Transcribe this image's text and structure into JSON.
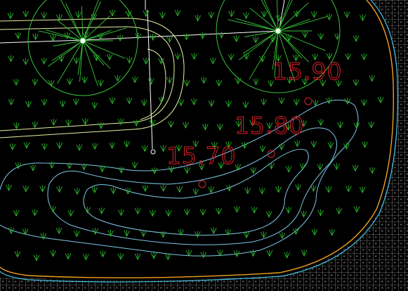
{
  "canvas": {
    "background": "#000000",
    "colors": {
      "contour": "#7fc8e6",
      "pond_edge_orange": "#f0a020",
      "pond_edge_cyan": "#49c3e8",
      "planting_green": "#2bb52b",
      "tree_green": "#39c43a",
      "path_lines": "#e6f0a0",
      "elevation_text": "#e0202a",
      "guide_white": "#ffffff",
      "paving_gray": "#cfcfcf"
    }
  },
  "elevation_markers": [
    {
      "label": "15.90",
      "icon": "spot-elevation-circle"
    },
    {
      "label": "15.80",
      "icon": "spot-elevation-circle"
    },
    {
      "label": "15.70",
      "icon": "spot-elevation-circle"
    }
  ],
  "trees": [
    {
      "icon": "tree-symbol"
    },
    {
      "icon": "tree-symbol"
    }
  ],
  "icons": {
    "grass": "grass-tuft-icon",
    "paving": "paving-grid-icon",
    "point": "survey-point-icon"
  }
}
